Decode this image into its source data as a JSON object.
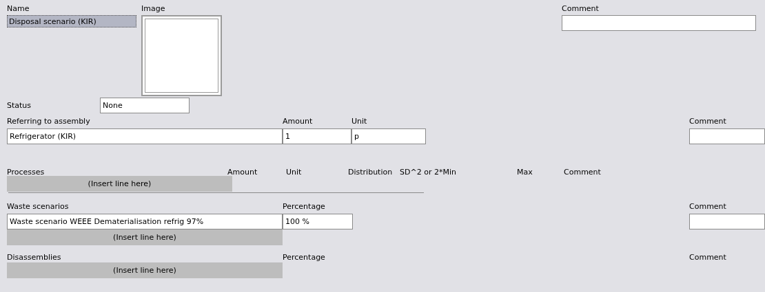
{
  "name": {
    "label": "Name",
    "value": "Disposal scenario (KIR)",
    "selected": true
  },
  "image": {
    "label": "Image"
  },
  "comment": {
    "label": "Comment"
  },
  "status": {
    "label": "Status",
    "value": "None"
  },
  "assembly": {
    "label": "Referring to assembly",
    "value": "Refrigerator (KIR)",
    "amount_label": "Amount",
    "amount": "1",
    "unit_label": "Unit",
    "unit": "p",
    "comment_label": "Comment"
  },
  "processes": {
    "columns": [
      "Processes",
      "Amount",
      "Unit",
      "Distribution",
      "SD^2 or 2*Min",
      "Max",
      "Comment"
    ],
    "insert_row": "(Insert line here)"
  },
  "waste_scenarios": {
    "label": "Waste scenarios",
    "percentage_label": "Percentage",
    "comment_label": "Comment",
    "rows": [
      {
        "name": "Waste scenario WEEE Dematerialisation refrig 97%",
        "percentage": "100 %"
      }
    ],
    "insert_row": "(Insert line here)"
  },
  "disassemblies": {
    "label": "Disassemblies",
    "percentage_label": "Percentage",
    "comment_label": "Comment",
    "insert_row": "(Insert line here)"
  }
}
